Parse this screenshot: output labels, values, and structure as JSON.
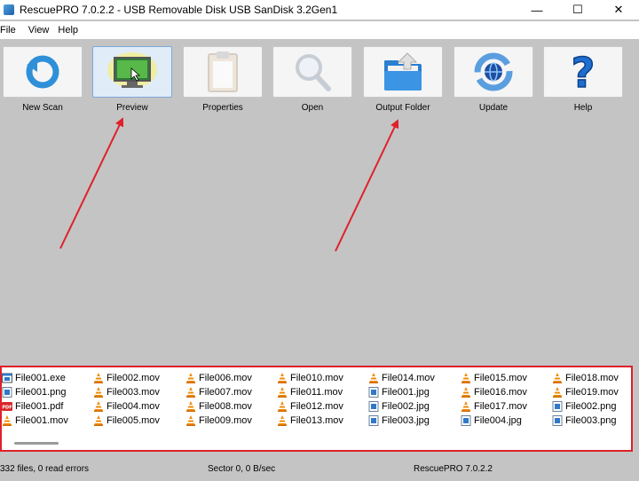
{
  "window": {
    "title": "RescuePRO 7.0.2.2 - USB Removable Disk USB SanDisk 3.2Gen1",
    "minimize": "—",
    "maximize": "☐",
    "close": "✕"
  },
  "menu": [
    "File",
    "View",
    "Help"
  ],
  "toolbar": [
    {
      "label": "New Scan",
      "icon": "new-scan-icon"
    },
    {
      "label": "Preview",
      "icon": "preview-icon"
    },
    {
      "label": "Properties",
      "icon": "properties-icon"
    },
    {
      "label": "Open",
      "icon": "open-icon"
    },
    {
      "label": "Output Folder",
      "icon": "output-folder-icon"
    },
    {
      "label": "Update",
      "icon": "update-icon"
    },
    {
      "label": "Help",
      "icon": "help-icon"
    }
  ],
  "files": [
    [
      {
        "name": "File001.exe",
        "type": "exe"
      },
      {
        "name": "File001.png",
        "type": "img"
      },
      {
        "name": "File001.pdf",
        "type": "pdf"
      },
      {
        "name": "File001.mov",
        "type": "vlc"
      }
    ],
    [
      {
        "name": "File002.mov",
        "type": "vlc"
      },
      {
        "name": "File003.mov",
        "type": "vlc"
      },
      {
        "name": "File004.mov",
        "type": "vlc"
      },
      {
        "name": "File005.mov",
        "type": "vlc"
      }
    ],
    [
      {
        "name": "File006.mov",
        "type": "vlc"
      },
      {
        "name": "File007.mov",
        "type": "vlc"
      },
      {
        "name": "File008.mov",
        "type": "vlc"
      },
      {
        "name": "File009.mov",
        "type": "vlc"
      }
    ],
    [
      {
        "name": "File010.mov",
        "type": "vlc"
      },
      {
        "name": "File011.mov",
        "type": "vlc"
      },
      {
        "name": "File012.mov",
        "type": "vlc"
      },
      {
        "name": "File013.mov",
        "type": "vlc"
      }
    ],
    [
      {
        "name": "File014.mov",
        "type": "vlc"
      },
      {
        "name": "File001.jpg",
        "type": "img"
      },
      {
        "name": "File002.jpg",
        "type": "img"
      },
      {
        "name": "File003.jpg",
        "type": "img"
      }
    ],
    [
      {
        "name": "File015.mov",
        "type": "vlc"
      },
      {
        "name": "File016.mov",
        "type": "vlc"
      },
      {
        "name": "File017.mov",
        "type": "vlc"
      },
      {
        "name": "File004.jpg",
        "type": "img"
      }
    ],
    [
      {
        "name": "File018.mov",
        "type": "vlc"
      },
      {
        "name": "File019.mov",
        "type": "vlc"
      },
      {
        "name": "File002.png",
        "type": "img"
      },
      {
        "name": "File003.png",
        "type": "img"
      }
    ]
  ],
  "status": {
    "files": "332 files, 0 read errors",
    "sector": "Sector 0, 0 B/sec",
    "version": "RescuePRO 7.0.2.2"
  },
  "colors": {
    "highlight": "#e0202a",
    "background": "#c4c4c4"
  }
}
